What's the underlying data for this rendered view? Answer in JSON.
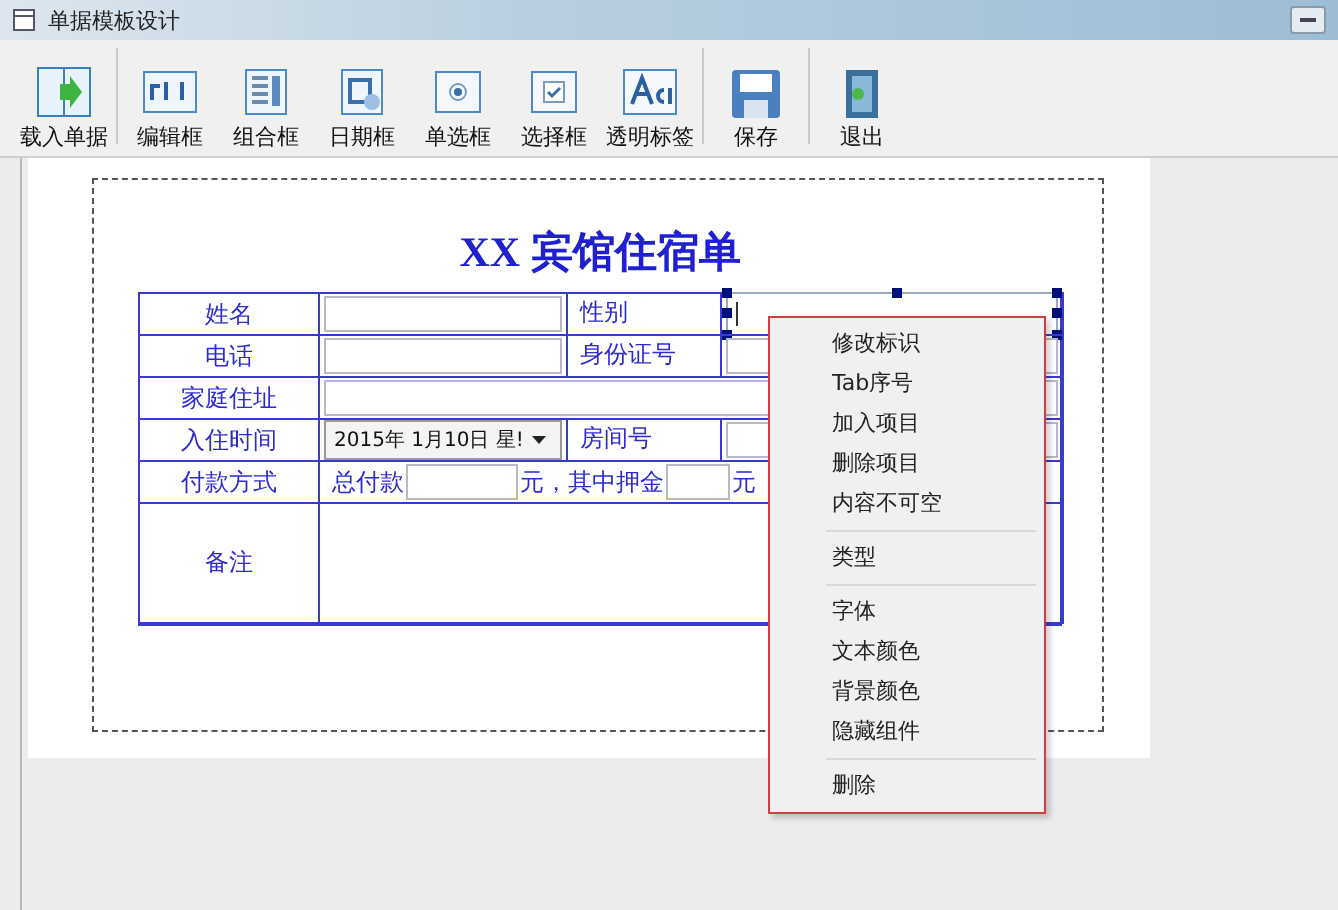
{
  "window": {
    "title": "单据模板设计"
  },
  "toolbar": [
    [
      {
        "label": "载入单据",
        "kind": "load"
      }
    ],
    [
      {
        "label": "编辑框",
        "kind": "edit"
      },
      {
        "label": "组合框",
        "kind": "combo"
      },
      {
        "label": "日期框",
        "kind": "date"
      },
      {
        "label": "单选框",
        "kind": "radio"
      },
      {
        "label": "选择框",
        "kind": "check"
      },
      {
        "label": "透明标签",
        "kind": "label"
      }
    ],
    [
      {
        "label": "保存",
        "kind": "save"
      }
    ],
    [
      {
        "label": "退出",
        "kind": "exit"
      }
    ]
  ],
  "form": {
    "title": "XX 宾馆住宿单",
    "rows": [
      {
        "label": "姓名",
        "cells": [
          {
            "kind": "input"
          },
          {
            "kind": "label",
            "text": "性别"
          },
          {
            "kind": "combo",
            "selected": true
          }
        ]
      },
      {
        "label": "电话",
        "cells": [
          {
            "kind": "input"
          },
          {
            "kind": "label",
            "text": "身份证号"
          },
          {
            "kind": "input"
          }
        ]
      },
      {
        "label": "家庭住址",
        "cells": [
          {
            "kind": "wide"
          }
        ]
      },
      {
        "label": "入住时间",
        "cells": [
          {
            "kind": "date",
            "value": "2015年 1月10日 星!"
          },
          {
            "kind": "label",
            "text": "房间号"
          },
          {
            "kind": "input"
          }
        ]
      },
      {
        "label": "付款方式",
        "cells": [
          {
            "kind": "payment",
            "parts": [
              "总付款",
              "元，其中押金",
              "元"
            ]
          }
        ]
      },
      {
        "label": "备注",
        "cells": [
          {
            "kind": "memo"
          }
        ]
      }
    ]
  },
  "context_menu": [
    [
      "修改标识",
      "Tab序号",
      "加入项目",
      "删除项目",
      "内容不可空"
    ],
    [
      "类型"
    ],
    [
      "字体",
      "文本颜色",
      "背景颜色",
      "隐藏组件"
    ],
    [
      "删除"
    ]
  ]
}
